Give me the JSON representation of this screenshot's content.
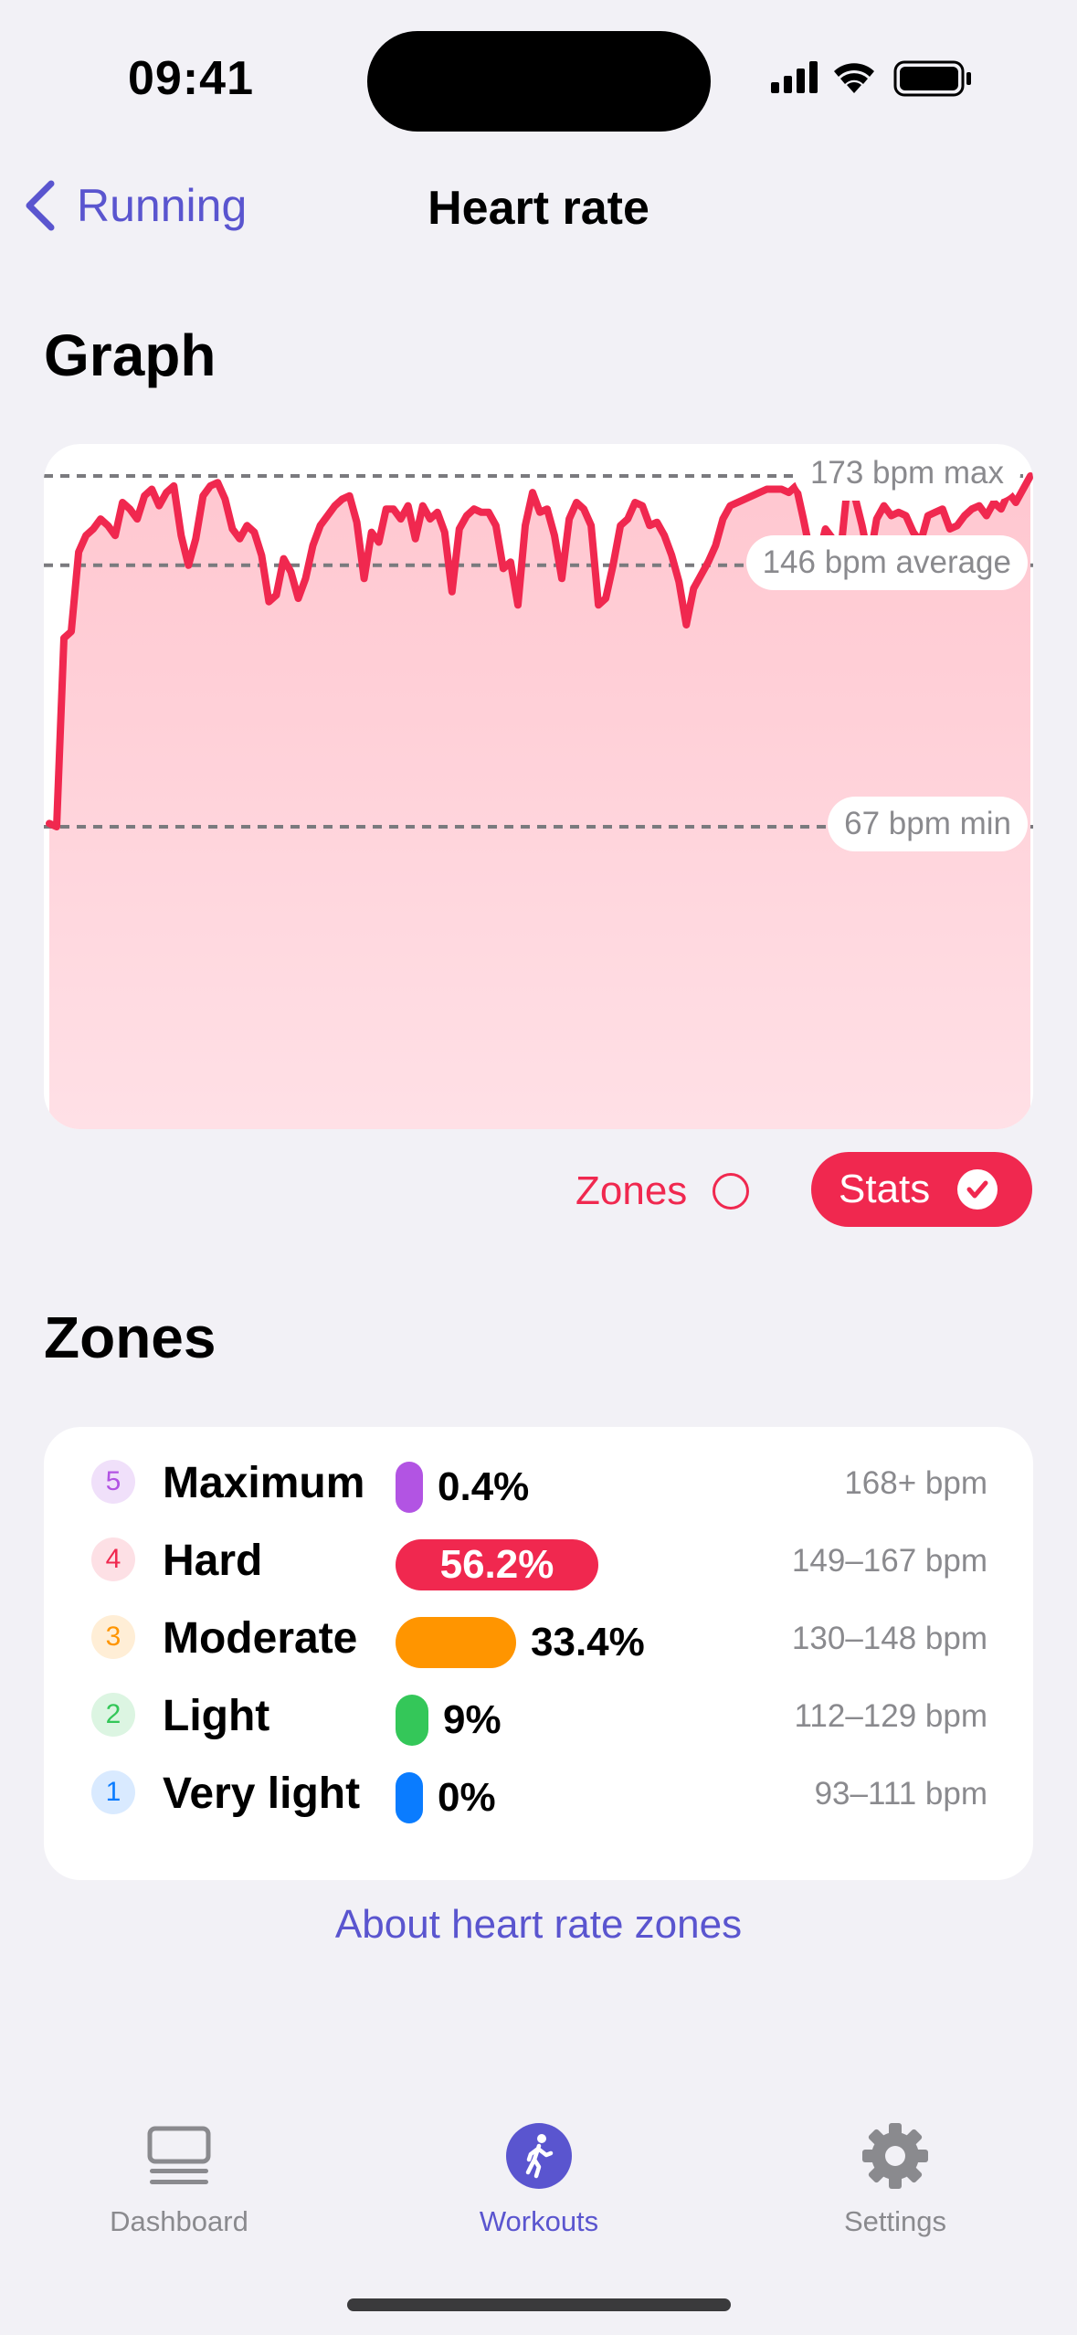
{
  "status_bar": {
    "time": "09:41"
  },
  "nav": {
    "back_label": "Running",
    "title": "Heart rate"
  },
  "graph_section": {
    "heading": "Graph"
  },
  "chart_data": {
    "type": "area",
    "title": "",
    "xlabel": "",
    "ylabel": "",
    "ylim": [
      60,
      180
    ],
    "series": [
      {
        "name": "",
        "color": "#f0284f",
        "values": [
          68,
          67,
          124,
          126,
          150,
          155,
          157,
          160,
          158,
          155,
          165,
          163,
          160,
          167,
          169,
          164,
          168,
          170,
          155,
          146,
          154,
          167,
          170,
          171,
          166,
          157,
          154,
          158,
          156,
          149,
          135,
          137,
          148,
          144,
          136,
          142,
          152,
          158,
          161,
          164,
          166,
          167,
          159,
          142,
          156,
          153,
          163,
          163,
          160,
          164,
          154,
          164,
          160,
          162,
          156,
          138,
          157,
          161,
          163,
          162,
          162,
          158,
          145,
          147,
          134,
          158,
          168,
          162,
          163,
          155,
          142,
          160,
          165,
          163,
          158,
          134,
          136,
          146,
          158,
          160,
          165,
          164,
          158,
          159,
          155,
          149,
          141,
          128,
          139,
          143,
          147,
          152,
          160,
          164,
          165,
          166,
          167,
          168,
          169,
          169,
          169,
          168,
          170,
          160,
          149,
          148,
          157,
          154,
          148,
          170,
          167,
          158,
          147,
          160,
          164,
          161,
          162,
          161,
          156,
          153,
          161,
          162,
          163,
          157,
          158,
          161,
          163,
          164,
          161,
          165,
          163,
          168,
          165,
          169,
          173
        ]
      }
    ],
    "reference_lines": [
      {
        "value": 173,
        "label": "173 bpm max"
      },
      {
        "value": 146,
        "label": "146 bpm average"
      },
      {
        "value": 67,
        "label": "67 bpm min"
      }
    ],
    "grid": false,
    "legend": "none"
  },
  "toggles": {
    "zones_label": "Zones",
    "stats_label": "Stats",
    "stats_active": true
  },
  "zones_section": {
    "heading": "Zones",
    "zones": [
      {
        "number": "5",
        "name": "Maximum",
        "percent": "0.4%",
        "fraction": 0.004,
        "range": "168+ bpm",
        "color": "#b254e3",
        "badge_bg": "#f0e0fa"
      },
      {
        "number": "4",
        "name": "Hard",
        "percent": "56.2%",
        "fraction": 0.562,
        "range": "149–167 bpm",
        "color": "#f0284f",
        "badge_bg": "#fde0e5"
      },
      {
        "number": "3",
        "name": "Moderate",
        "percent": "33.4%",
        "fraction": 0.334,
        "range": "130–148 bpm",
        "color": "#ff9500",
        "badge_bg": "#ffeed6"
      },
      {
        "number": "2",
        "name": "Light",
        "percent": "9%",
        "fraction": 0.09,
        "range": "112–129 bpm",
        "color": "#34c759",
        "badge_bg": "#dcf5e2"
      },
      {
        "number": "1",
        "name": "Very light",
        "percent": "0%",
        "fraction": 0.0,
        "range": "93–111 bpm",
        "color": "#0a7cff",
        "badge_bg": "#d9eaff"
      }
    ],
    "about_link": "About heart rate zones"
  },
  "tab_bar": {
    "items": [
      {
        "label": "Dashboard",
        "icon": "dashboard-icon",
        "active": false
      },
      {
        "label": "Workouts",
        "icon": "figure-walk-icon",
        "active": true
      },
      {
        "label": "Settings",
        "icon": "gear-icon",
        "active": false
      }
    ]
  },
  "colors": {
    "accent": "#5a55cf",
    "heart": "#f0284f",
    "background": "#f2f1f6"
  }
}
